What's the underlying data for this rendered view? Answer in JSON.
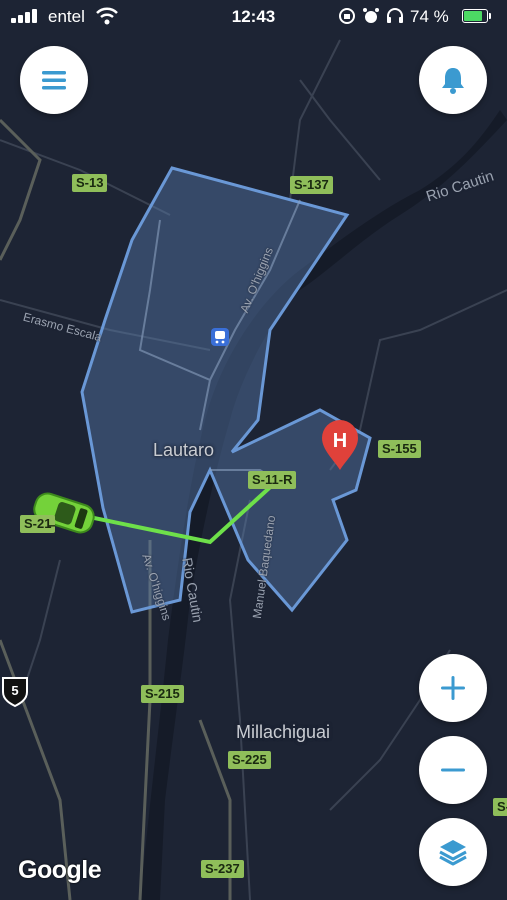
{
  "status_bar": {
    "carrier": "entel",
    "time": "12:43",
    "battery_percent": "74 %",
    "battery_level": 0.74
  },
  "map": {
    "places": {
      "main_town": "Lautaro",
      "secondary_town": "Millachiguai"
    },
    "roads": {
      "s13": "S-13",
      "s137": "S-137",
      "s155": "S-155",
      "s11r": "S-11-R",
      "s215_left": "S-21̶",
      "s215": "S-215",
      "s225": "S-225",
      "s237": "S-237",
      "s_edge": "S-",
      "route5": "5"
    },
    "streets": {
      "rio_cautin_ne": "Rio Cautin",
      "av_ohiggins_n": "Av. O'higgins",
      "erasmo_escala": "Erasmo Escala",
      "av_ohiggins_s": "Av. O'higgins",
      "rio_cautin_s": "Rio Cautin",
      "manuel_bulnes": "Manuel Baquedano"
    },
    "hospital_marker": "H",
    "brand": "Google",
    "colors": {
      "background": "#1d2434",
      "zone_fill": "#5a7fb0",
      "zone_stroke": "#6a98d6",
      "route": "#6ee04a",
      "marker": "#e0413a",
      "accent": "#3b9ad0"
    }
  },
  "controls": {
    "menu": "menu-icon",
    "notifications": "bell-icon",
    "zoom_in": "plus-icon",
    "zoom_out": "minus-icon",
    "layers": "layers-icon"
  }
}
